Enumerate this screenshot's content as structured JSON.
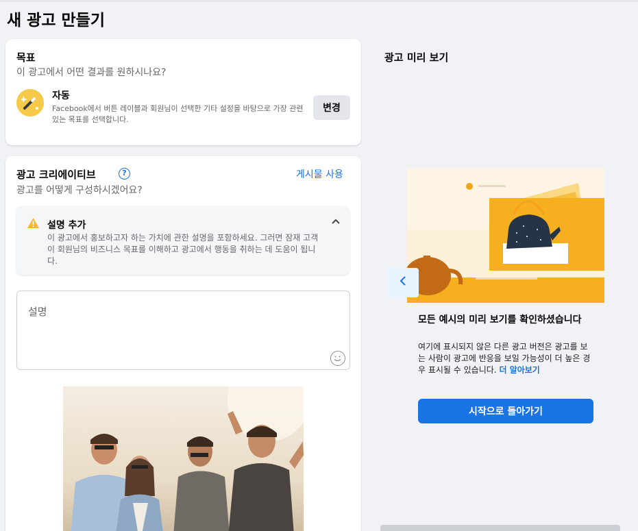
{
  "page": {
    "title": "새 광고 만들기"
  },
  "goal": {
    "title": "목표",
    "subtitle": "이 광고에서 어떤 결과를 원하시나요?",
    "option_label": "자동",
    "option_desc": "Facebook에서 버튼 레이블과 회원님이 선택한 기타 설정을 바탕으로 가장 관련 있는 목표를 선택합니다.",
    "change_label": "변경",
    "icon": "magic-wand-icon"
  },
  "creative": {
    "title": "광고 크리에이티브",
    "subtitle": "광고를 어떻게 구성하시겠어요?",
    "use_post_label": "게시물 사용",
    "tip": {
      "title": "설명 추가",
      "text": "이 광고에서 홍보하고자 하는 가치에 관한 설명을 포함하세요. 그러면 잠재 고객이 회원님의 비즈니스 목표를 이해하고 광고에서 행동을 취하는 데 도움이 됩니다."
    },
    "description_placeholder": "설명"
  },
  "preview": {
    "title": "광고 미리 보기",
    "message_title": "모든 예시의 미리 보기를 확인하셨습니다",
    "message_body": "여기에 표시되지 않은 다른 광고 버전은 광고를 보는 사람이 광고에 반응을 보일 가능성이 더 높은 경우 표시될 수 있습니다.",
    "learn_more": "더 알아보기",
    "start_over_label": "시작으로 돌아가기"
  },
  "colors": {
    "accent": "#1b74e4",
    "link": "#216fdb",
    "background": "#f0f2f5",
    "warning": "#f7b928"
  }
}
